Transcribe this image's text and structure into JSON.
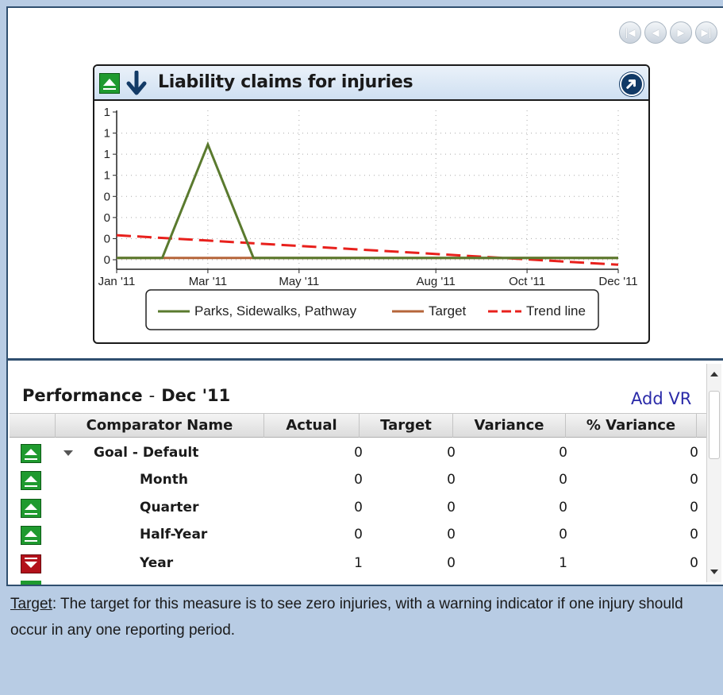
{
  "navigation": {
    "first_icon": "first-page-icon",
    "prev_icon": "previous-icon",
    "next_icon": "next-icon",
    "last_icon": "last-page-icon"
  },
  "chart_card": {
    "title": "Liability claims for injuries",
    "status_icon": "status-up-icon",
    "trend_icon": "trend-down-arrow-icon",
    "expand_icon": "expand-link-icon"
  },
  "chart_data": {
    "type": "line",
    "x_tick_labels": [
      "Jan '11",
      "Mar '11",
      "May '11",
      "Aug '11",
      "Oct '11",
      "Dec '11"
    ],
    "x_tick_months": [
      1,
      3,
      5,
      8,
      10,
      12
    ],
    "y_tick_labels": [
      "1",
      "1",
      "1",
      "1",
      "0",
      "0",
      "0",
      "0"
    ],
    "grid": true,
    "legend_position": "bottom",
    "series": [
      {
        "name": "Parks, Sidewalks, Pathway",
        "style": "solid",
        "color": "#5a7a2e",
        "points": [
          [
            1,
            0
          ],
          [
            2,
            0
          ],
          [
            3,
            1
          ],
          [
            4,
            0
          ],
          [
            12,
            0
          ]
        ]
      },
      {
        "name": "Target",
        "style": "solid",
        "color": "#b5653a",
        "points": [
          [
            1,
            0
          ],
          [
            12,
            0
          ]
        ]
      },
      {
        "name": "Trend line",
        "style": "dashed",
        "color": "#e8201c",
        "points": [
          [
            1,
            0.2
          ],
          [
            12,
            -0.06
          ]
        ]
      }
    ],
    "y_range": [
      -0.1,
      1.3
    ]
  },
  "performance": {
    "title": "Performance",
    "separator": "-",
    "period": "Dec '11",
    "add_vr_label": "Add VR",
    "columns": [
      "Comparator Name",
      "Actual",
      "Target",
      "Variance",
      "% Variance"
    ],
    "rows": [
      {
        "status": "up",
        "name": "Goal - Default",
        "actual": "0",
        "target": "0",
        "variance": "0",
        "pct": "0",
        "expandable": true
      },
      {
        "status": "up",
        "name": "Month",
        "actual": "0",
        "target": "0",
        "variance": "0",
        "pct": "0"
      },
      {
        "status": "up",
        "name": "Quarter",
        "actual": "0",
        "target": "0",
        "variance": "0",
        "pct": "0"
      },
      {
        "status": "up",
        "name": "Half-Year",
        "actual": "0",
        "target": "0",
        "variance": "0",
        "pct": "0"
      },
      {
        "status": "down",
        "name": "Year",
        "actual": "1",
        "target": "0",
        "variance": "1",
        "pct": "0"
      }
    ]
  },
  "note": {
    "label": "Target",
    "colon": ":",
    "text": "The target for this measure is to see zero injuries, with a warning indicator if one injury should occur in any one reporting period."
  },
  "colors": {
    "status_up": "#1f9a2f",
    "status_down": "#b3121b",
    "link": "#2a2aa8",
    "frame": "#2f4f6f"
  }
}
